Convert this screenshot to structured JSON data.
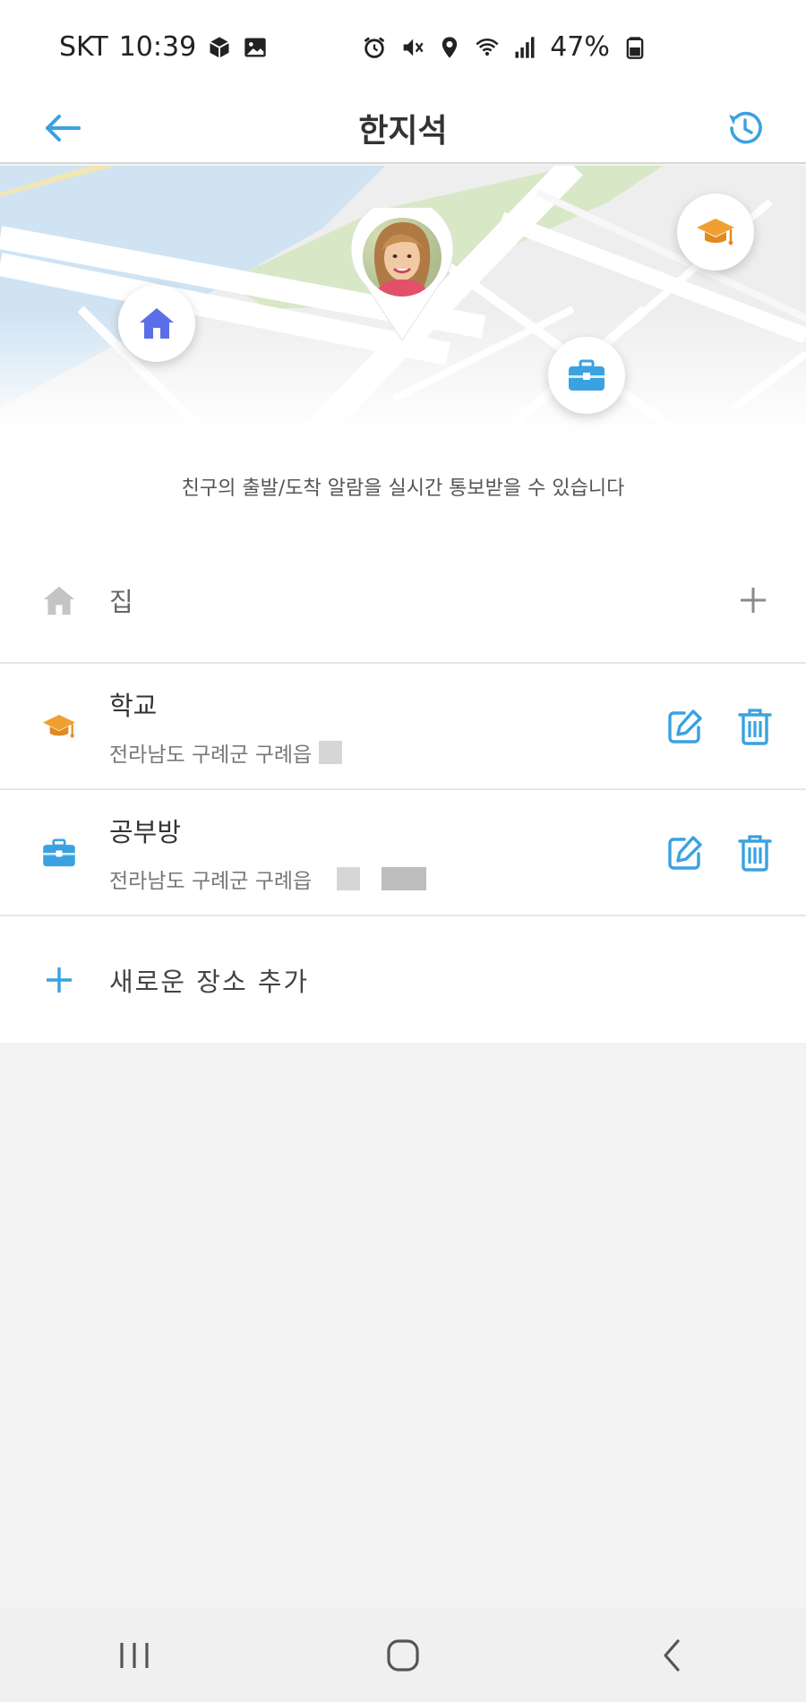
{
  "status_bar": {
    "carrier": "SKT",
    "time": "10:39",
    "battery": "47%"
  },
  "app_bar": {
    "title": "한지석",
    "back_icon": "arrow-left-icon",
    "history_icon": "history-icon"
  },
  "map": {
    "avatar": "profile-photo",
    "pins": [
      "home-icon",
      "graduation-cap-icon",
      "briefcase-icon"
    ]
  },
  "notice": "친구의 출발/도착 알람을 실시간 통보받을 수 있습니다",
  "places": [
    {
      "title": "집",
      "subtitle": "",
      "icon": "home-icon",
      "action": "add"
    },
    {
      "title": "학교",
      "subtitle": "전라남도 구례군 구례읍",
      "icon": "graduation-cap-icon",
      "action": "edit-delete"
    },
    {
      "title": "공부방",
      "subtitle": "전라남도 구례군 구례읍",
      "icon": "briefcase-icon",
      "action": "edit-delete"
    }
  ],
  "add_place_label": "새로운 장소 추가",
  "colors": {
    "accent": "#3aa2e0",
    "home_pin": "#5b6ee8",
    "school": "#f0a030",
    "briefcase": "#3aa2e0"
  }
}
